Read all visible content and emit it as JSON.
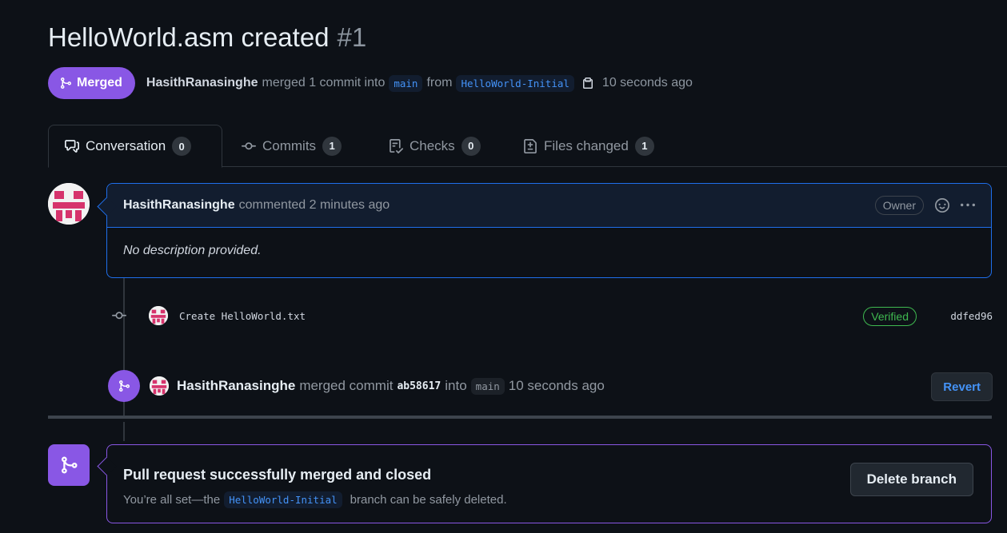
{
  "pull_request": {
    "title": "HelloWorld.asm created",
    "number": "#1",
    "state": "Merged",
    "author": "HasithRanasinghe",
    "merged_text": "merged 1 commit into",
    "base_branch": "main",
    "from_text": "from",
    "head_branch": "HelloWorld-Initial",
    "time": "10 seconds ago"
  },
  "tabs": [
    {
      "label": "Conversation",
      "count": "0",
      "icon": "comment-discussion-icon"
    },
    {
      "label": "Commits",
      "count": "1",
      "icon": "git-commit-icon"
    },
    {
      "label": "Checks",
      "count": "0",
      "icon": "checklist-icon"
    },
    {
      "label": "Files changed",
      "count": "1",
      "icon": "file-diff-icon"
    }
  ],
  "comment": {
    "author": "HasithRanasinghe",
    "action": "commented 2 minutes ago",
    "role_label": "Owner",
    "body": "No description provided."
  },
  "commit": {
    "message": "Create HelloWorld.txt",
    "verified_label": "Verified",
    "sha": "ddfed96"
  },
  "merge_event": {
    "author": "HasithRanasinghe",
    "action": "merged commit",
    "sha": "ab58617",
    "into_text": "into",
    "branch": "main",
    "time": "10 seconds ago",
    "revert_label": "Revert"
  },
  "merged_box": {
    "title": "Pull request successfully merged and closed",
    "desc_before": "You’re all set—the",
    "branch": "HelloWorld-Initial",
    "desc_after": "branch can be safely deleted.",
    "delete_label": "Delete branch"
  },
  "colors": {
    "background": "#0d1117",
    "merged_purple": "#8957e5",
    "link_blue": "#4493f8",
    "verified_green": "#3fb950"
  }
}
